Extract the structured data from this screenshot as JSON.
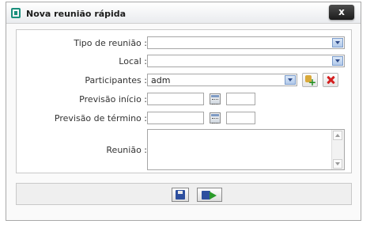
{
  "dialog": {
    "title": "Nova reunião rápida",
    "close_label": "x"
  },
  "form": {
    "tipo_label": "Tipo de reunião :",
    "tipo_value": "",
    "local_label": "Local :",
    "local_value": "",
    "participantes_label": "Participantes :",
    "participantes_value": "adm",
    "previsao_inicio_label": "Previsão início :",
    "previsao_termino_label": "Previsão de término :",
    "reuniao_label": "Reunião :"
  },
  "colors": {
    "accent": "#1a8f7c",
    "delete": "#d42020",
    "add": "#1d8d1d"
  },
  "icons": {
    "app": "app-logo-icon",
    "calendar": "calendar-icon",
    "add_participant": "add-participant-icon",
    "remove_participant": "remove-participant-icon",
    "save": "save-icon",
    "send": "send-icon"
  }
}
